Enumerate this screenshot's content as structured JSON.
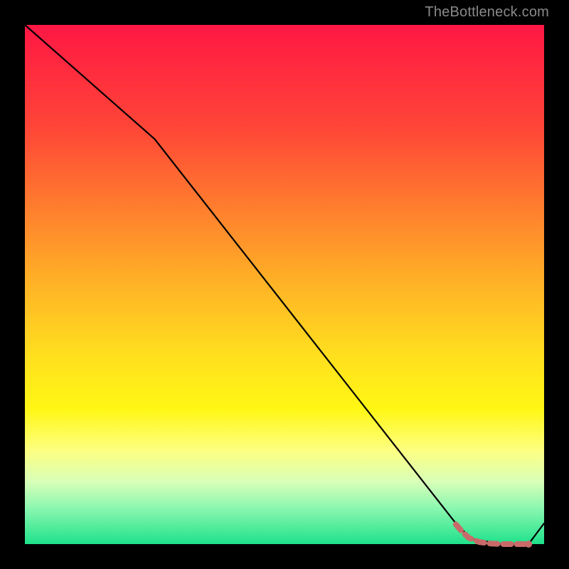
{
  "watermark": "TheBottleneck.com",
  "chart_data": {
    "type": "line",
    "title": "",
    "xlabel": "",
    "ylabel": "",
    "xlim": [
      0,
      100
    ],
    "ylim": [
      0,
      100
    ],
    "grid": false,
    "legend": false,
    "series": [
      {
        "name": "curve",
        "color": "#000000",
        "x": [
          0,
          25,
          83,
          86,
          92,
          97,
          100
        ],
        "y": [
          100,
          78,
          4,
          1,
          0,
          0,
          4
        ]
      }
    ],
    "markers": {
      "name": "dotted-bottom",
      "color": "#c96a6a",
      "points": [
        {
          "x": 83.0,
          "y": 3.8
        },
        {
          "x": 84.2,
          "y": 2.4
        },
        {
          "x": 85.5,
          "y": 1.2
        },
        {
          "x": 87.5,
          "y": 0.4
        },
        {
          "x": 89.8,
          "y": 0.1
        },
        {
          "x": 92.3,
          "y": 0.0
        },
        {
          "x": 94.8,
          "y": 0.0
        },
        {
          "x": 97.0,
          "y": 0.0
        }
      ]
    }
  }
}
